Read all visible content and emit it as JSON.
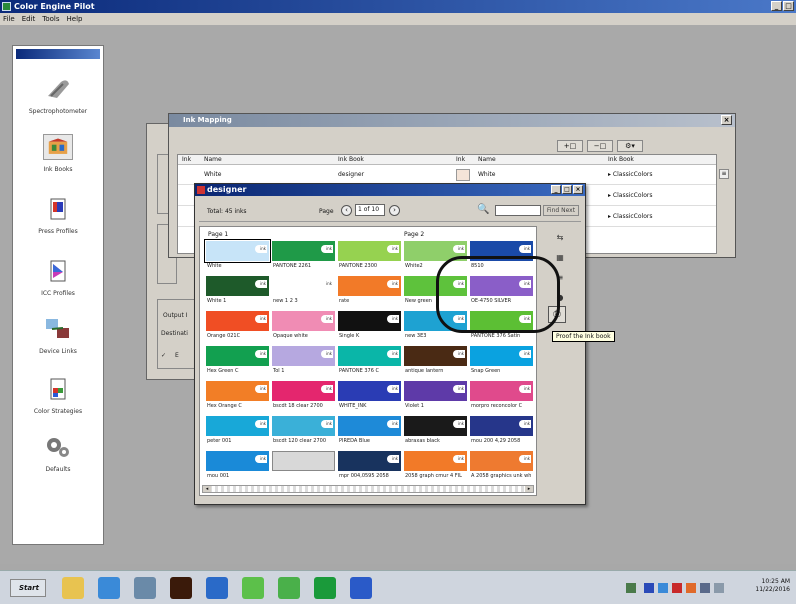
{
  "app": {
    "title": "Color Engine Pilot",
    "menu": [
      "File",
      "Edit",
      "Tools",
      "Help"
    ],
    "window_buttons": [
      "_",
      "□",
      "×"
    ]
  },
  "sidebar": {
    "items": [
      {
        "label": "Spectrophotometer",
        "icon": "spectrophotometer-icon"
      },
      {
        "label": "Ink Books",
        "icon": "ink-books-icon"
      },
      {
        "label": "Press Profiles",
        "icon": "press-profiles-icon"
      },
      {
        "label": "ICC Profiles",
        "icon": "icc-profiles-icon"
      },
      {
        "label": "Device Links",
        "icon": "device-links-icon"
      },
      {
        "label": "Color Strategies",
        "icon": "color-strategies-icon"
      },
      {
        "label": "Defaults",
        "icon": "defaults-icon"
      }
    ]
  },
  "back_dialog": {
    "output_label": "Output I",
    "dest_label": "Destinati",
    "check_label": "E"
  },
  "ink_mapping": {
    "title": "Ink Mapping",
    "columns_left": [
      "Ink",
      "Name",
      "Ink Book"
    ],
    "columns_right": [
      "Ink",
      "Name",
      "Ink Book"
    ],
    "rows": [
      {
        "name_left": "White",
        "book_left": "designer",
        "name_right": "White",
        "book_right": "▸ ClassicColors",
        "swatch": "#f4e4d8"
      },
      {
        "name_left": "",
        "book_left": "",
        "name_right": "",
        "book_right": "▸ ClassicColors",
        "swatch": "#f07a30"
      },
      {
        "name_left": "",
        "book_left": "",
        "name_right": "",
        "book_right": "▸ ClassicColors",
        "swatch": "#a070c0"
      }
    ]
  },
  "designer": {
    "title": "designer",
    "total_label": "Total: 45 inks",
    "page_label": "Page",
    "page_value": "1 of 10",
    "find_label": "Find Next",
    "page1_label": "Page 1",
    "page2_label": "Page 2",
    "swatches": [
      {
        "name": "White",
        "color": "#c7e4f8",
        "selected": true
      },
      {
        "name": "PANTONE 2261",
        "color": "#1f9a48",
        "selected": false
      },
      {
        "name": "PANTONE 2300",
        "color": "#96d250",
        "selected": false
      },
      {
        "name": "White2",
        "color": "#8fcf6a",
        "selected": false
      },
      {
        "name": "8510",
        "color": "#1a4aa8",
        "selected": false
      },
      {
        "name": "White 1",
        "color": "#1e5a2a",
        "selected": false
      },
      {
        "name": "new 1 2 3",
        "color": "#ffffff",
        "selected": false
      },
      {
        "name": "rate",
        "color": "#f27a28",
        "selected": false
      },
      {
        "name": "New green",
        "color": "#5ec23c",
        "selected": false
      },
      {
        "name": "OE-4750 SILVER",
        "color": "#8a5ec8",
        "selected": false
      },
      {
        "name": "Orange 021C",
        "color": "#f04e24",
        "selected": false
      },
      {
        "name": "Opaque white",
        "color": "#f08cb4",
        "selected": false
      },
      {
        "name": "Single K",
        "color": "#111111",
        "selected": false
      },
      {
        "name": "new 3E3",
        "color": "#1ea2d2",
        "selected": false
      },
      {
        "name": "PANTONE 376 Satin",
        "color": "#5cbf34",
        "selected": false
      },
      {
        "name": "Hex Green C",
        "color": "#12a050",
        "selected": false
      },
      {
        "name": "Tol 1",
        "color": "#b6a8e0",
        "selected": false
      },
      {
        "name": "PANTONE 376 C",
        "color": "#0ab6a8",
        "selected": false
      },
      {
        "name": "antique lantern",
        "color": "#4a2a14",
        "selected": false
      },
      {
        "name": "Snap Green",
        "color": "#0aa2e0",
        "selected": false
      },
      {
        "name": "Hex Orange C",
        "color": "#f27e26",
        "selected": false
      },
      {
        "name": "bscdt 18 clear 2700",
        "color": "#e4266e",
        "selected": false
      },
      {
        "name": "WHITE_INK",
        "color": "#2a3cb4",
        "selected": false
      },
      {
        "name": "Violet 1",
        "color": "#5e3aa8",
        "selected": false
      },
      {
        "name": "morpro reconcolor C",
        "color": "#e04a8c",
        "selected": false
      },
      {
        "name": "peter 001",
        "color": "#18a8d8",
        "selected": false
      },
      {
        "name": "bscdt 120 clear 2700",
        "color": "#3ab0d8",
        "selected": false
      },
      {
        "name": "PIREDA Blue",
        "color": "#1e8ad8",
        "selected": false
      },
      {
        "name": "abraxas black",
        "color": "#1a1a1a",
        "selected": false
      },
      {
        "name": "mou 200 4,29 2058",
        "color": "#26368a",
        "selected": false
      },
      {
        "name": "mou 001",
        "color": "#1a8ad8",
        "selected": false
      },
      {
        "name": "",
        "color": "#d8d8d8",
        "selected": false
      },
      {
        "name": "mpr 004,0595 2058",
        "color": "#18335e",
        "selected": false
      },
      {
        "name": "2058 graph cmur 4 FIL",
        "color": "#f27a28",
        "selected": false
      },
      {
        "name": "A 2058 graphics unk wh",
        "color": "#ee7a30",
        "selected": false
      }
    ],
    "tooltip": "Proof the Ink book"
  },
  "taskbar": {
    "start_label": "Start",
    "time": "10:25 AM",
    "date": "11/22/2016",
    "apps": [
      {
        "name": "file-explorer-icon",
        "color": "#e8c350"
      },
      {
        "name": "media-icon",
        "color": "#3a8ad8"
      },
      {
        "name": "network-icon",
        "color": "#6a8aa8"
      },
      {
        "name": "illustrator-icon",
        "color": "#3a1a0a"
      },
      {
        "name": "color-app-icon",
        "color": "#2a6ac8"
      },
      {
        "name": "green-app-1-icon",
        "color": "#5cc04a"
      },
      {
        "name": "green-app-2-icon",
        "color": "#4ab04a"
      },
      {
        "name": "color-engine-icon",
        "color": "#1a9a3a"
      },
      {
        "name": "help-icon",
        "color": "#2a5ac8"
      }
    ]
  }
}
